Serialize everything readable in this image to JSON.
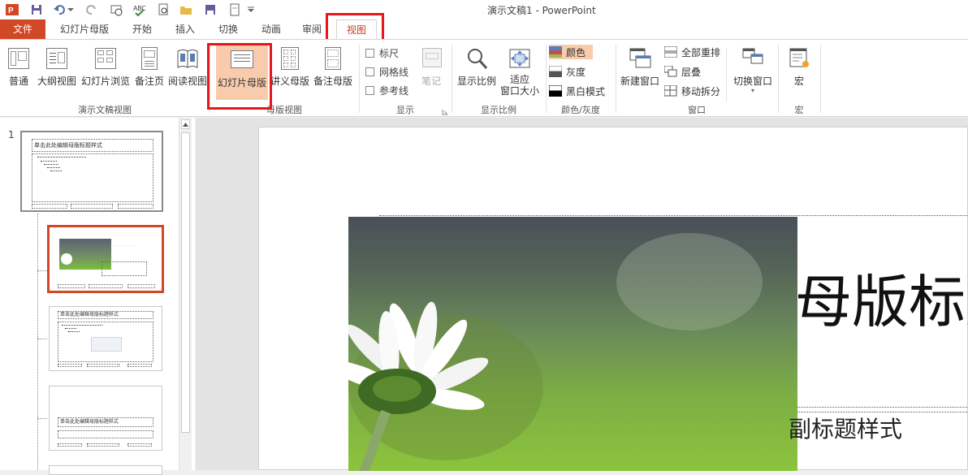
{
  "titlebar": {
    "title": "演示文稿1 - PowerPoint"
  },
  "tabs": [
    {
      "label": "文件"
    },
    {
      "label": "幻灯片母版"
    },
    {
      "label": "开始"
    },
    {
      "label": "插入"
    },
    {
      "label": "切换"
    },
    {
      "label": "动画"
    },
    {
      "label": "审阅"
    },
    {
      "label": "视图"
    }
  ],
  "ribbon": {
    "presentation_views": {
      "label": "演示文稿视图",
      "buttons": [
        "普通",
        "大纲视图",
        "幻灯片浏览",
        "备注页",
        "阅读视图"
      ]
    },
    "master_views": {
      "label": "母版视图",
      "buttons": [
        "幻灯片母版",
        "讲义母版",
        "备注母版"
      ]
    },
    "show": {
      "label": "显示",
      "checks": [
        "标尺",
        "网格线",
        "参考线"
      ],
      "notes": "笔记"
    },
    "zoom": {
      "label": "显示比例",
      "buttons": [
        "显示比例",
        "适应",
        "窗口大小"
      ]
    },
    "color": {
      "label": "颜色/灰度",
      "items": [
        "颜色",
        "灰度",
        "黑白模式"
      ]
    },
    "window": {
      "label": "窗口",
      "new_window": "新建窗口",
      "items": [
        "全部重排",
        "层叠",
        "移动拆分"
      ],
      "switch": "切换窗口"
    },
    "macro": {
      "label": "宏",
      "button": "宏"
    }
  },
  "thumbnails": {
    "number": "1",
    "master_title": "单击此处编辑母版标题样式",
    "layout_title": "单击此处编辑母版标题样式"
  },
  "slide": {
    "title_fragment": "母版标题",
    "subtitle_fragment": "副标题样式"
  },
  "colors": {
    "accent": "#d24726",
    "highlight": "#e8151b",
    "active_btn": "#f8cbad"
  }
}
